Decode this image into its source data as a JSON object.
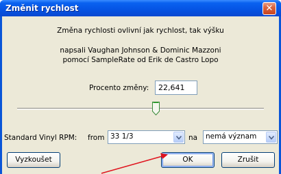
{
  "dialog": {
    "title": "Změnit rychlost",
    "close_glyph": "✕",
    "description": "Změna rychlosti ovlivní jak rychlost, tak výšku",
    "credits_line1": "napsali Vaughan Johnson & Dominic Mazzoni",
    "credits_line2": "pomocí SampleRate od Erik de Castro Lopo"
  },
  "percent": {
    "label": "Procento změny:",
    "value": "22,641"
  },
  "slider": {
    "position_fraction": 0.56
  },
  "vinyl": {
    "label": "Standard Vinyl RPM:",
    "from_label": "from",
    "from_value": "33 1/3",
    "to_label": "na",
    "to_value": "nemá význam"
  },
  "buttons": {
    "preview": "Vyzkoušet",
    "ok": "OK",
    "cancel": "Zrušit"
  },
  "colors": {
    "titlebar": "#0553e3",
    "dialog_bg": "#ece9d8",
    "annotation_arrow": "#e0141e"
  }
}
